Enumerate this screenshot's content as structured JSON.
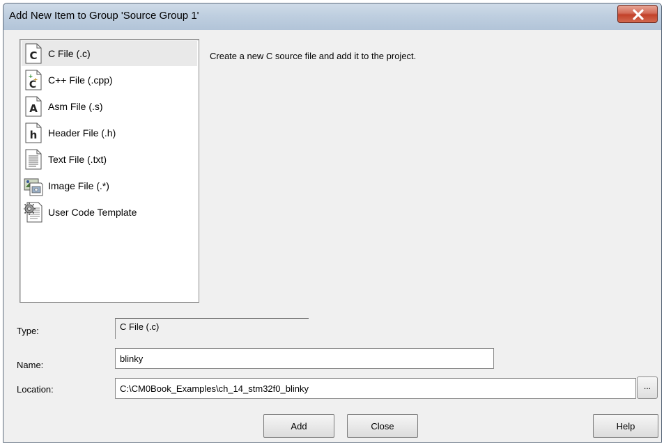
{
  "window": {
    "title": "Add New Item to Group 'Source Group 1'",
    "close_glyph": "X"
  },
  "file_types": [
    {
      "label": "C File (.c)",
      "icon": "c-file-icon",
      "selected": true
    },
    {
      "label": "C++ File (.cpp)",
      "icon": "cpp-file-icon",
      "selected": false
    },
    {
      "label": "Asm File (.s)",
      "icon": "asm-file-icon",
      "selected": false
    },
    {
      "label": "Header File (.h)",
      "icon": "header-file-icon",
      "selected": false
    },
    {
      "label": "Text File (.txt)",
      "icon": "text-file-icon",
      "selected": false
    },
    {
      "label": "Image File (.*)",
      "icon": "image-file-icon",
      "selected": false
    },
    {
      "label": "User Code Template",
      "icon": "template-file-icon",
      "selected": false
    }
  ],
  "description": "Create a new C source file and add it to the project.",
  "form": {
    "type_label": "Type:",
    "type_value": "C File (.c)",
    "name_label": "Name:",
    "name_value": "blinky",
    "location_label": "Location:",
    "location_value": "C:\\CM0Book_Examples\\ch_14_stm32f0_blinky",
    "browse_label": "..."
  },
  "buttons": {
    "add": "Add",
    "close": "Close",
    "help": "Help"
  },
  "colors": {
    "titlebar": "#bfcfe0",
    "close_button": "#c2412a",
    "dialog_bg": "#f0f0f0",
    "selected_item": "#e9e9e9"
  }
}
